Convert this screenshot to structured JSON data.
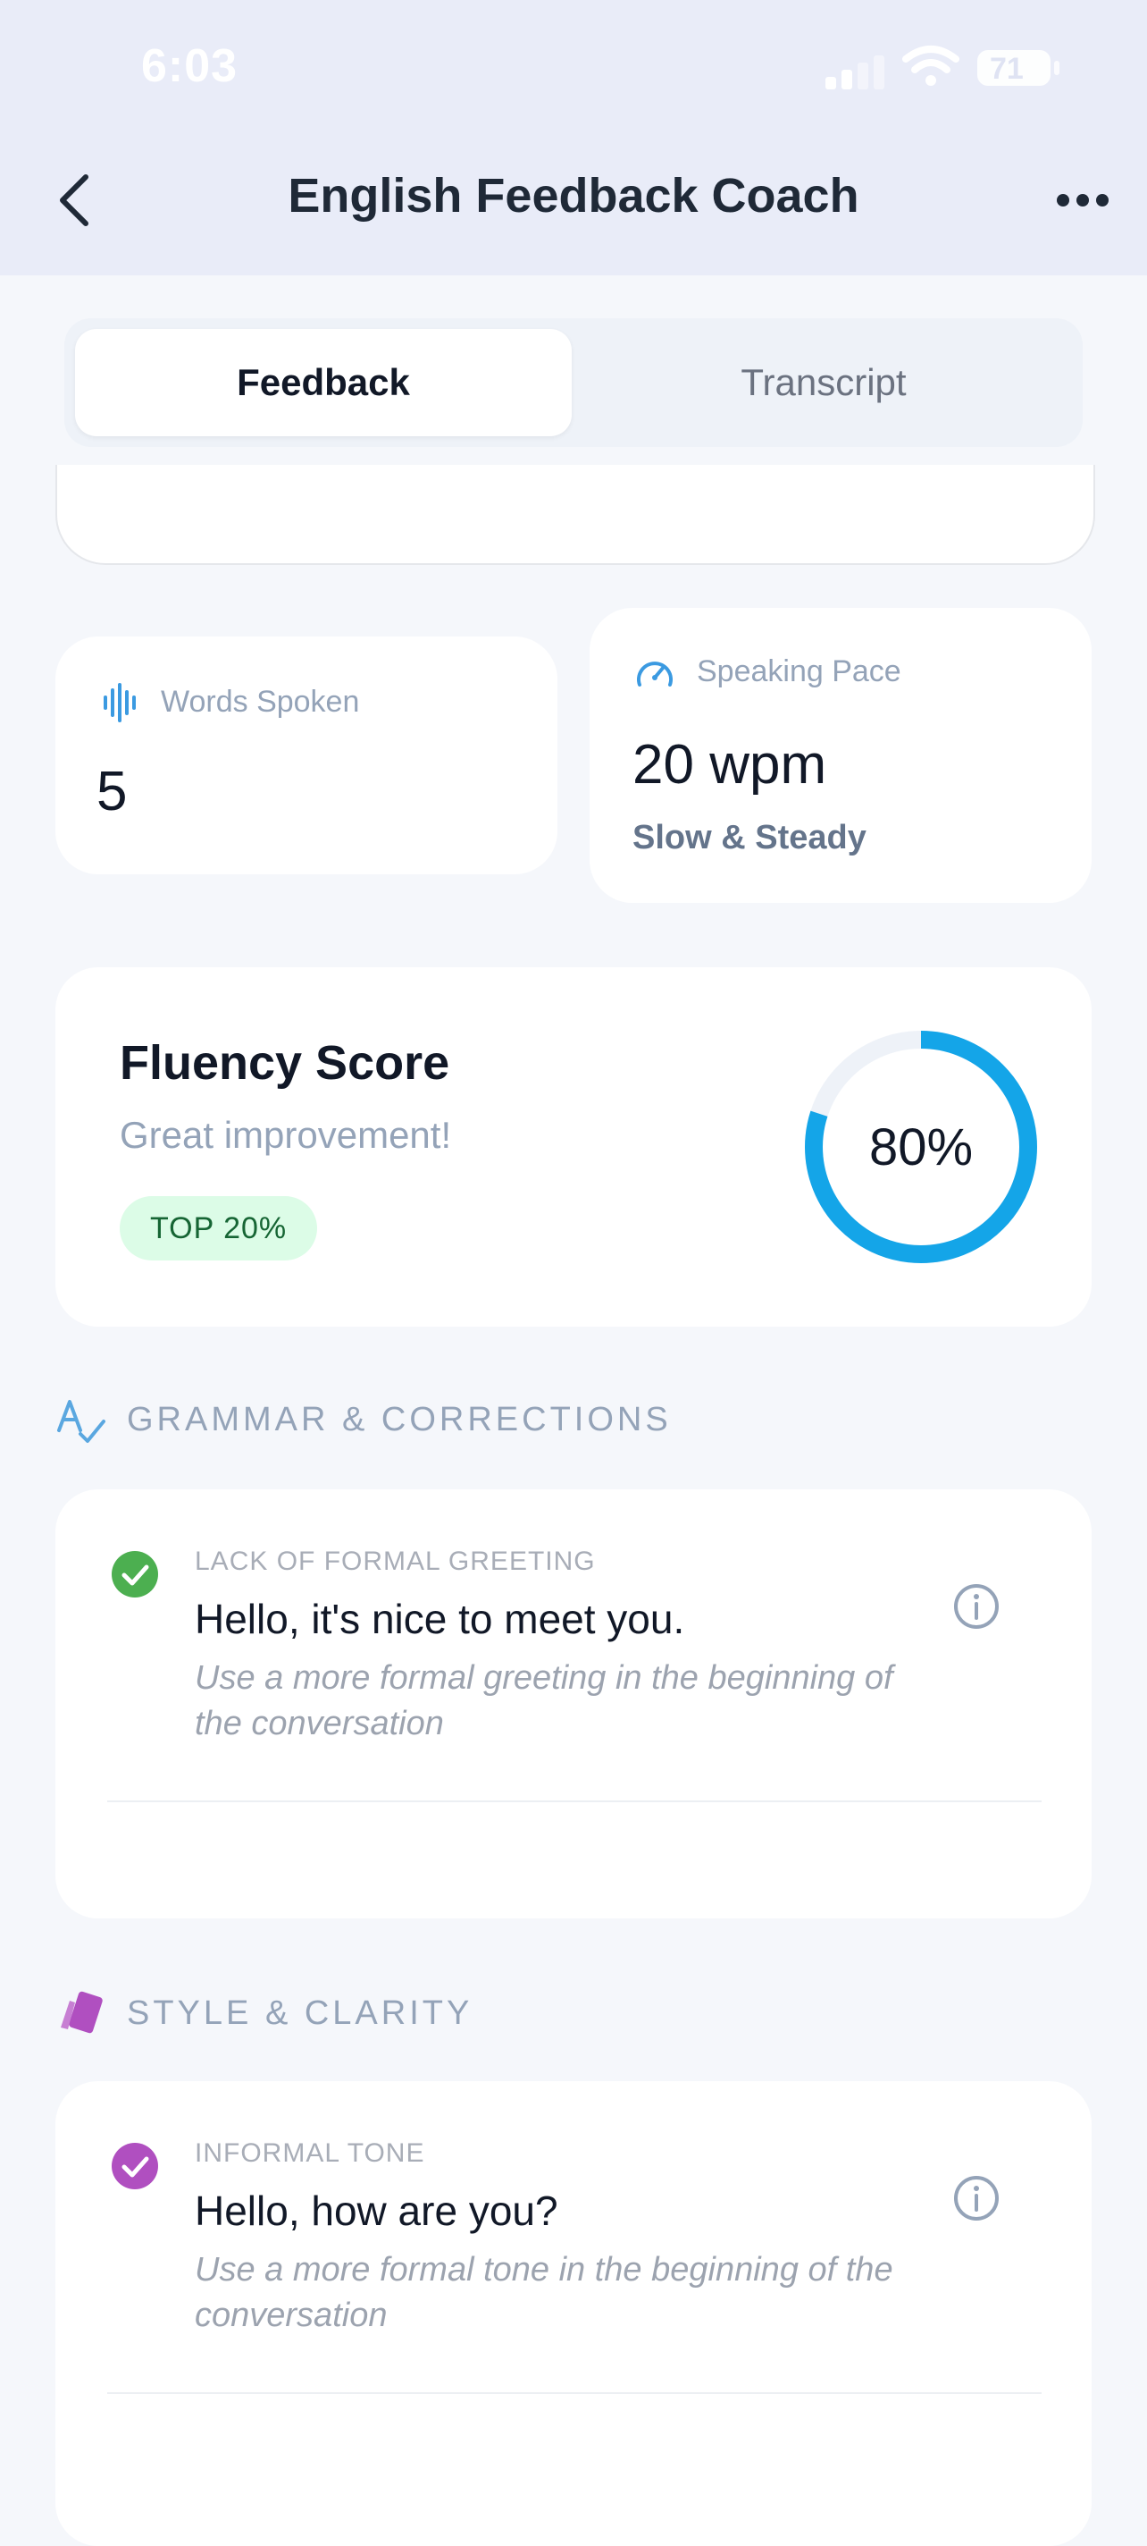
{
  "status_bar": {
    "time": "6:03",
    "battery": "71"
  },
  "nav": {
    "title": "English Feedback Coach"
  },
  "tabs": [
    {
      "label": "Feedback",
      "active": true
    },
    {
      "label": "Transcript",
      "active": false
    }
  ],
  "stats": {
    "words": {
      "label": "Words Spoken",
      "value": "5",
      "icon": "waveform-icon"
    },
    "pace": {
      "label": "Speaking Pace",
      "value": "20 wpm",
      "sub": "Slow & Steady",
      "icon": "speedometer-icon"
    }
  },
  "fluency": {
    "title": "Fluency Score",
    "subtitle": "Great improvement!",
    "badge": "TOP 20%",
    "score_text": "80%",
    "score": 80,
    "ring_color": "#14a5e8",
    "ring_track_color": "#eef2f8"
  },
  "sections": {
    "grammar": {
      "title": "GRAMMAR & CORRECTIONS",
      "icon": "spell-check-icon",
      "accent": "#5aa7e0",
      "items": [
        {
          "category": "LACK OF FORMAL GREETING",
          "text": "Hello, it's nice to meet you.",
          "hint": "Use a more formal greeting in the beginning of the conversation",
          "check_color": "#4caf50"
        }
      ]
    },
    "style": {
      "title": "STYLE & CLARITY",
      "icon": "tag-icon",
      "accent": "#b04fc0",
      "items": [
        {
          "category": "INFORMAL TONE",
          "text": "Hello, how are you?",
          "hint": "Use a more formal tone in the beginning of the conversation",
          "check_color": "#b04fc0"
        }
      ]
    }
  }
}
